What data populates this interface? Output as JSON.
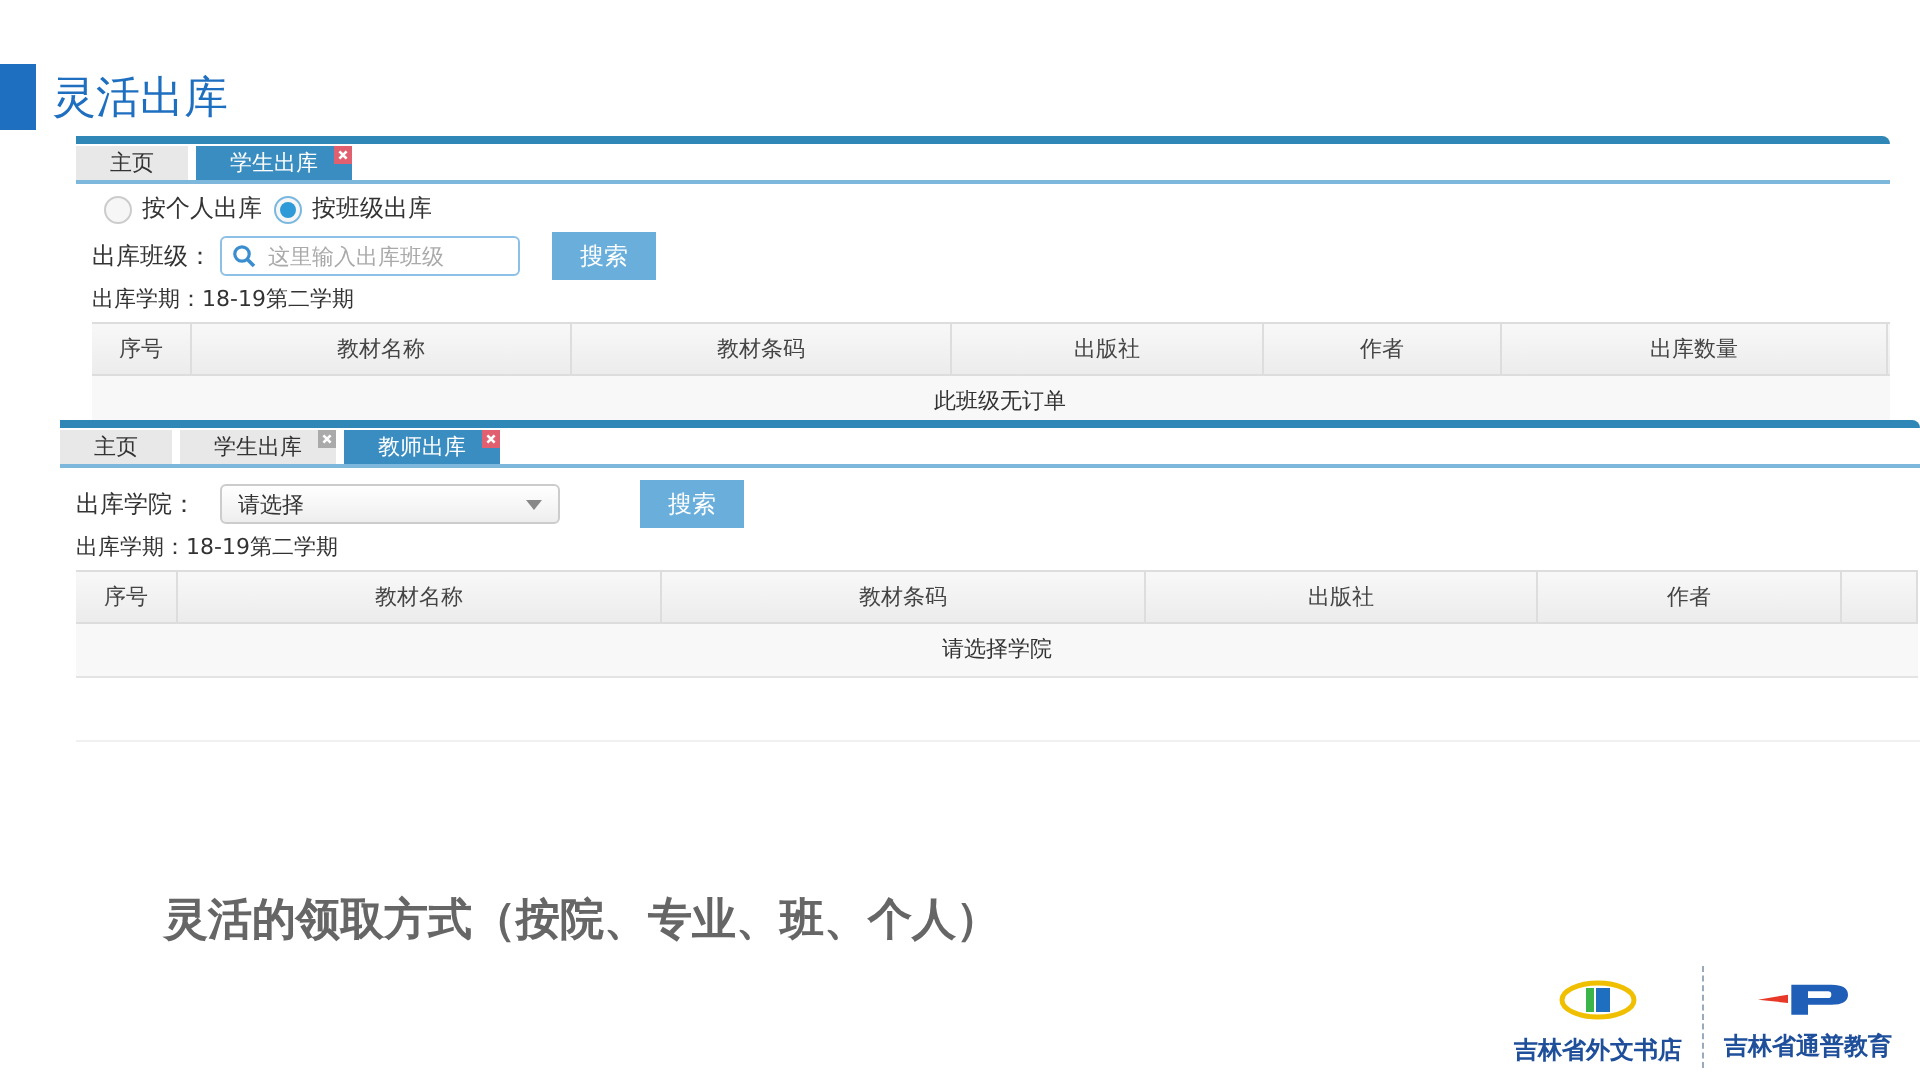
{
  "slide_title": "灵活出库",
  "panels": [
    {
      "tabs": [
        {
          "label": "主页",
          "selected": false,
          "closable": false
        },
        {
          "label": "学生出库",
          "selected": true,
          "closable": true
        }
      ],
      "radios": [
        {
          "label": "按个人出库",
          "selected": false
        },
        {
          "label": "按班级出库",
          "selected": true
        }
      ],
      "filter": {
        "kind": "search",
        "label": "出库班级：",
        "placeholder": "这里输入出库班级",
        "button": "搜索"
      },
      "term": "出库学期：18-19第二学期",
      "columns": [
        "序号",
        "教材名称",
        "教材条码",
        "出版社",
        "作者",
        "出库数量"
      ],
      "empty_message": "此班级无订单"
    },
    {
      "tabs": [
        {
          "label": "主页",
          "selected": false,
          "closable": false
        },
        {
          "label": "学生出库",
          "selected": false,
          "closable": true
        },
        {
          "label": "教师出库",
          "selected": true,
          "closable": true
        }
      ],
      "filter": {
        "kind": "select",
        "label": "出库学院：",
        "value": "请选择",
        "button": "搜索"
      },
      "term": "出库学期：18-19第二学期",
      "columns": [
        "序号",
        "教材名称",
        "教材条码",
        "出版社",
        "作者"
      ],
      "empty_message": "请选择学院"
    }
  ],
  "caption": "灵活的领取方式（按院、专业、班、个人）",
  "logos": [
    {
      "name": "吉林省外文书店"
    },
    {
      "name": "吉林省通普教育"
    }
  ]
}
